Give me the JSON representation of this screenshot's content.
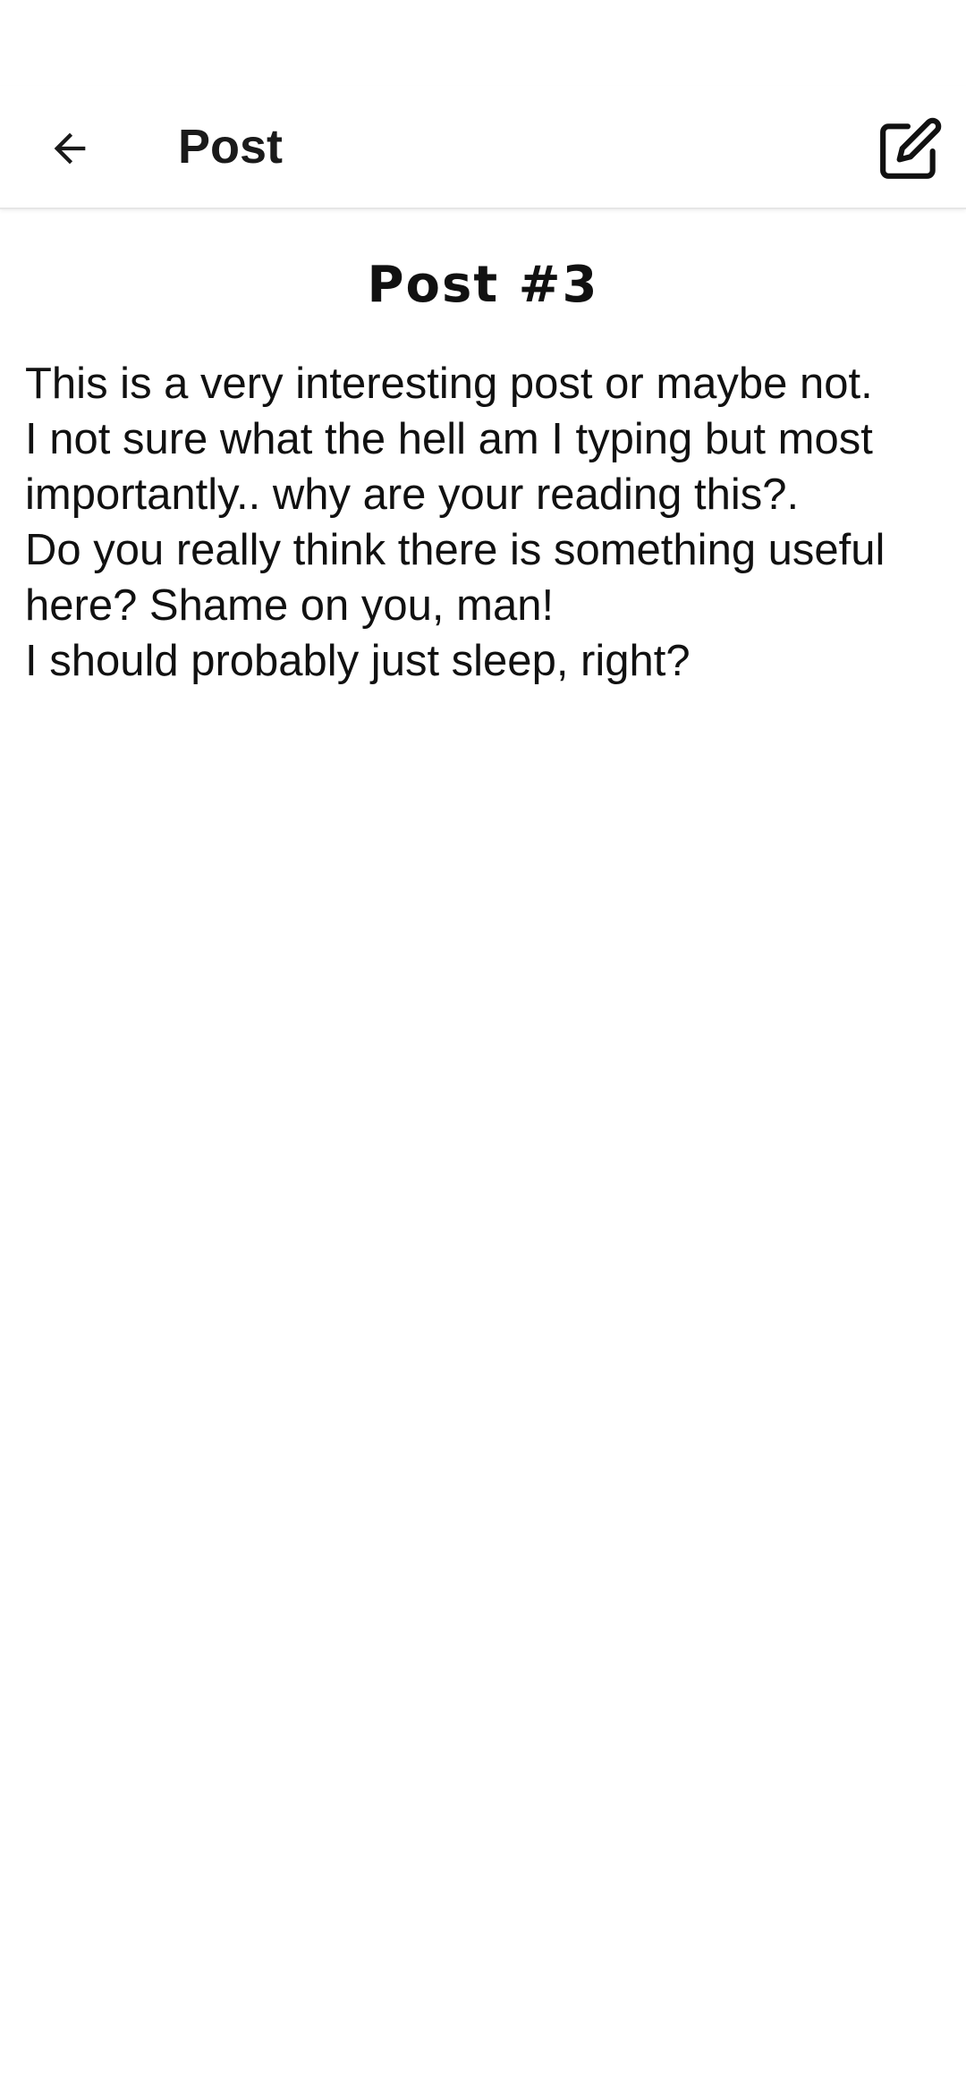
{
  "app_bar": {
    "title": "Post",
    "back_icon": "arrow-left-icon",
    "edit_icon": "edit-icon"
  },
  "post": {
    "title": "Post #3",
    "body": "This is a very interesting post or maybe not.\nI not sure what the hell am I typing but most importantly.. why are your reading this?.\nDo you really think there is something useful here? Shame on you, man!\nI should probably just sleep, right?"
  }
}
